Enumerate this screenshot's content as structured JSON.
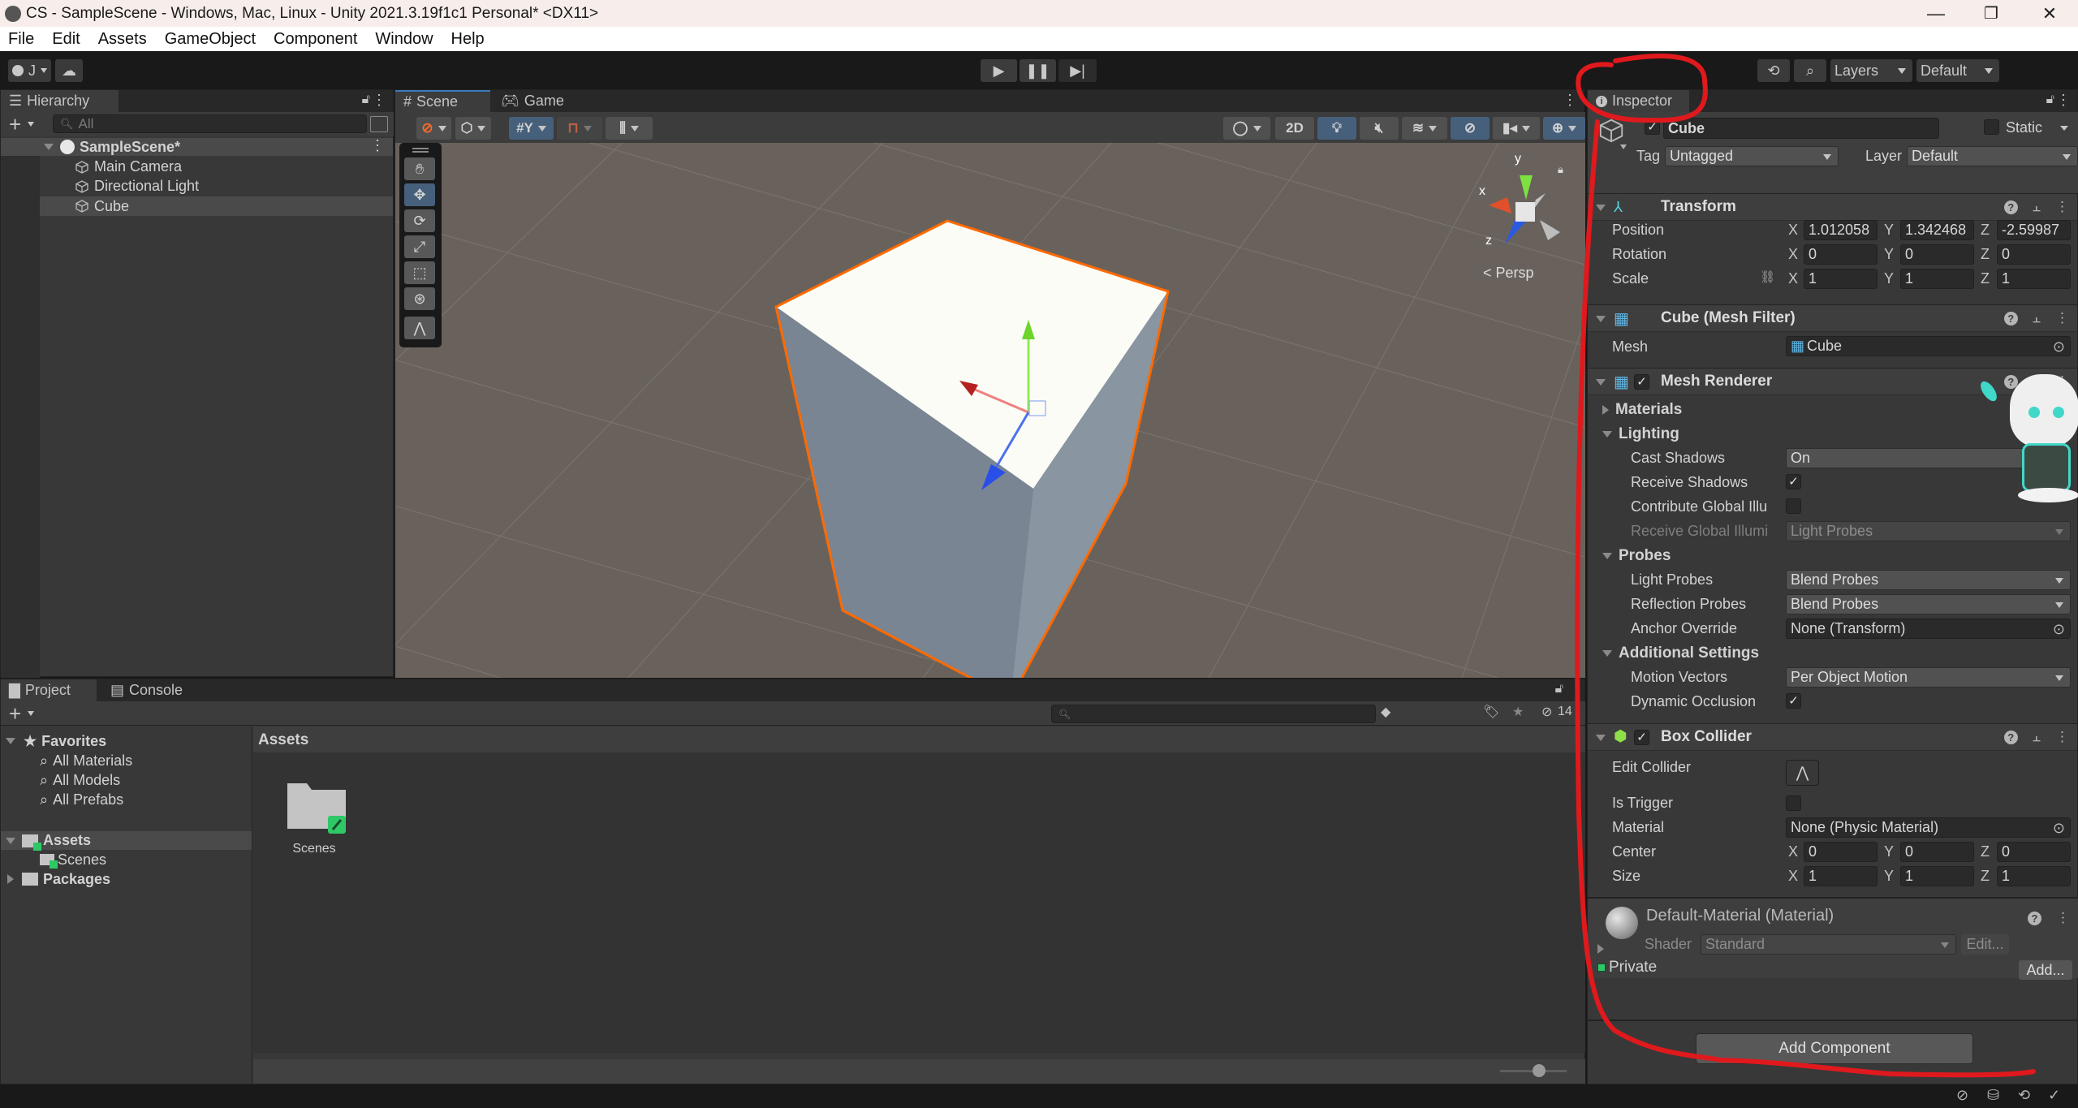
{
  "window": {
    "title": "CS - SampleScene - Windows, Mac, Linux - Unity 2021.3.19f1c1 Personal* <DX11>",
    "minimize": "—",
    "maximize": "❐",
    "close": "✕"
  },
  "menu": [
    "File",
    "Edit",
    "Assets",
    "GameObject",
    "Component",
    "Window",
    "Help"
  ],
  "toolbar": {
    "account_label": "J",
    "layers_label": "Layers",
    "layout_label": "Default"
  },
  "hierarchy": {
    "tab": "Hierarchy",
    "search_placeholder": "All",
    "scene": "SampleScene*",
    "items": [
      "Main Camera",
      "Directional Light",
      "Cube"
    ],
    "selected": "Cube"
  },
  "scene_view": {
    "tabs": [
      "Scene",
      "Game"
    ],
    "active_tab": "Scene",
    "mode_2d": "2D",
    "projection_label": "Persp",
    "gizmo_axes": {
      "x": "x",
      "y": "y",
      "z": "z"
    },
    "selection_outline_color": "#ff6a00"
  },
  "project": {
    "tabs": [
      "Project",
      "Console"
    ],
    "active_tab": "Project",
    "favorites_label": "Favorites",
    "favorites": [
      "All Materials",
      "All Models",
      "All Prefabs"
    ],
    "tree": {
      "assets": "Assets",
      "assets_children": [
        "Scenes"
      ],
      "packages": "Packages"
    },
    "breadcrumb": "Assets",
    "grid_items": [
      "Scenes"
    ],
    "hidden_count": "14",
    "zoom_slider_fraction": 0.58
  },
  "inspector": {
    "tab": "Inspector",
    "object_name": "Cube",
    "active": true,
    "static_label": "Static",
    "static": false,
    "tag_label": "Tag",
    "tag_value": "Untagged",
    "layer_label": "Layer",
    "layer_value": "Default",
    "transform": {
      "title": "Transform",
      "position": {
        "label": "Position",
        "x": "1.012058",
        "y": "1.342468",
        "z": "-2.59987"
      },
      "rotation": {
        "label": "Rotation",
        "x": "0",
        "y": "0",
        "z": "0"
      },
      "scale": {
        "label": "Scale",
        "x": "1",
        "y": "1",
        "z": "1"
      }
    },
    "mesh_filter": {
      "title": "Cube (Mesh Filter)",
      "mesh_label": "Mesh",
      "mesh_value": "Cube"
    },
    "mesh_renderer": {
      "title": "Mesh Renderer",
      "enabled": true,
      "materials_label": "Materials",
      "lighting_label": "Lighting",
      "cast_shadows_label": "Cast Shadows",
      "cast_shadows_value": "On",
      "receive_shadows_label": "Receive Shadows",
      "receive_shadows": true,
      "contribute_gi_label": "Contribute Global Illu",
      "contribute_gi": false,
      "receive_gi_label": "Receive Global Illumi",
      "receive_gi_value": "Light Probes",
      "probes_label": "Probes",
      "light_probes_label": "Light Probes",
      "light_probes_value": "Blend Probes",
      "reflection_probes_label": "Reflection Probes",
      "reflection_probes_value": "Blend Probes",
      "anchor_override_label": "Anchor Override",
      "anchor_override_value": "None (Transform)",
      "additional_settings_label": "Additional Settings",
      "motion_vectors_label": "Motion Vectors",
      "motion_vectors_value": "Per Object Motion",
      "dynamic_occlusion_label": "Dynamic Occlusion",
      "dynamic_occlusion": true
    },
    "box_collider": {
      "title": "Box Collider",
      "enabled": true,
      "edit_collider_label": "Edit Collider",
      "is_trigger_label": "Is Trigger",
      "is_trigger": false,
      "material_label": "Material",
      "material_value": "None (Physic Material)",
      "center": {
        "label": "Center",
        "x": "0",
        "y": "0",
        "z": "0"
      },
      "size": {
        "label": "Size",
        "x": "1",
        "y": "1",
        "z": "1"
      }
    },
    "material": {
      "title": "Default-Material (Material)",
      "shader_label": "Shader",
      "shader_value": "Standard",
      "edit_label": "Edit...",
      "private_label": "Private",
      "add_label": "Add..."
    },
    "add_component": "Add Component"
  },
  "annotation": {
    "color": "#e0191d"
  }
}
